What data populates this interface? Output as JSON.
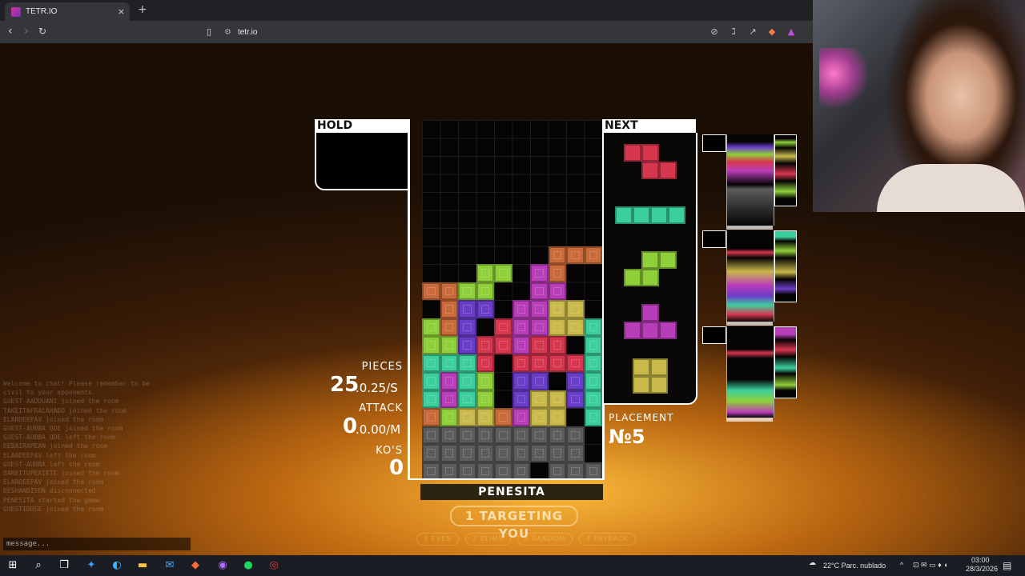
{
  "browser": {
    "tab_title": "TETR.IO",
    "tab_close": "×",
    "new_tab": "+",
    "url": "tetr.io"
  },
  "game": {
    "hold_label": "HOLD",
    "next_label": "NEXT",
    "stats": {
      "pieces_label": "PIECES",
      "pieces_value": "25",
      "pieces_rate": ".0.25/S",
      "attack_label": "ATTACK",
      "attack_value": "0",
      "attack_rate": ".0.00/M",
      "kos_label": "KO'S",
      "kos_value": "0"
    },
    "placement_label": "PLACEMENT",
    "placement_value": "№5",
    "player_name": "PENESITA",
    "targeting": "1 TARGETING YOU",
    "strategies": [
      "1 EVEN",
      "2 ELIMS",
      "3 RANDOM",
      "4 PAYBACK"
    ],
    "colors": {
      "Z": "#d6374f",
      "I": "#3ccf9c",
      "S": "#8fcf3a",
      "T": "#b83db8",
      "O": "#c8b94a",
      "L": "#c86a3a",
      "J": "#6a3dc8",
      "G": "#5c5c5c"
    },
    "next_queue": [
      "Z",
      "I",
      "S",
      "T",
      "O"
    ],
    "board_rows": [
      "..........",
      "..........",
      "..........",
      "..........",
      "..........",
      "..........",
      "..........",
      "...........",
      ".......LLL",
      "...SS.TL..",
      "LLSS..TT..",
      ".LJJ.TTOO.",
      "SLJ.ZTTOOI",
      "SSJZZTZZ.I",
      "IIIZ.ZZZZI",
      "ITIS.JJ.JI",
      "ITIS.JOOJI",
      "LSOOLTOO.I",
      "GGGGGGGGG.",
      "GGGGGGGGG.",
      "GGGGGG.GGG"
    ],
    "chat_lines": [
      "Welcome to chat! Please remember to be",
      "civil to your opponents.",
      "GUEST-AADDUANI joined the room",
      "TAKEITAFRACAHADO joined the room",
      "ELARDEEPAV joined the room",
      "GUEST-AUBBA_QDE joined the room",
      "GUEST-AUBBA_QDE left the room",
      "DEBAIRAPEAN joined the room",
      "ELARDEEPAV left the room",
      "GUEST-AUBBA left the room",
      "DAREITUPEXIETE joined the room",
      "ELARDEEPAV joined the room",
      "DESHANDISON disconnected",
      "PENESITA started the game",
      "GUESTIDDSE joined the room"
    ],
    "chat_placeholder": "message..."
  },
  "taskbar": {
    "weather": "22°C  Parc. nublado",
    "time": "03:00",
    "date": "28/3/2026"
  }
}
